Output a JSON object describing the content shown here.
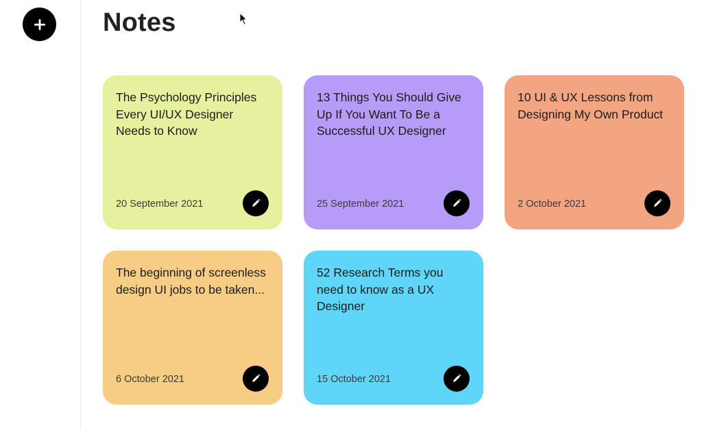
{
  "header": {
    "title": "Notes"
  },
  "sidebar": {
    "add_icon": "plus-icon"
  },
  "notes": [
    {
      "text": "The Psychology Principles Every UI/UX Designer Needs to Know",
      "date": "20 September 2021",
      "color": "#E6F09E",
      "edit_icon": "pencil-icon"
    },
    {
      "text": "13 Things You Should Give Up If You Want To Be a Successful UX Designer",
      "date": "25 September 2021",
      "color": "#B69CF8",
      "edit_icon": "pencil-icon"
    },
    {
      "text": "10 UI & UX Lessons from Designing My Own Product",
      "date": "2 October 2021",
      "color": "#F3A582",
      "edit_icon": "pencil-icon"
    },
    {
      "text": "The beginning of screenless design UI jobs to be taken...",
      "date": "6 October 2021",
      "color": "#F7CD85",
      "edit_icon": "pencil-icon"
    },
    {
      "text": "52 Research Terms you need to know as a UX Designer",
      "date": "15 October 2021",
      "color": "#5FD6F9",
      "edit_icon": "pencil-icon"
    }
  ]
}
